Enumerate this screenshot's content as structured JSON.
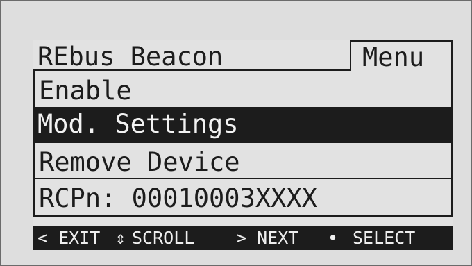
{
  "screen": {
    "title": "REbus Beacon",
    "menu_label": "Menu"
  },
  "menu": {
    "items": [
      {
        "label": "Enable",
        "selected": false
      },
      {
        "label": "Mod. Settings",
        "selected": true
      },
      {
        "label": "Remove Device",
        "selected": false
      }
    ]
  },
  "device": {
    "rcpn": "RCPn: 00010003XXXX"
  },
  "footer": {
    "exit": "< EXIT",
    "scroll_icon": "up-down-arrow-icon",
    "scroll_glyph": "⇕",
    "scroll": "SCROLL",
    "next": "> NEXT",
    "select_icon": "bullet-icon",
    "select_glyph": "•",
    "select": "SELECT"
  },
  "colors": {
    "lcd_background": "#e2e2e2",
    "lcd_foreground": "#1c1c1c",
    "frame_border": "#6b6b6b"
  }
}
